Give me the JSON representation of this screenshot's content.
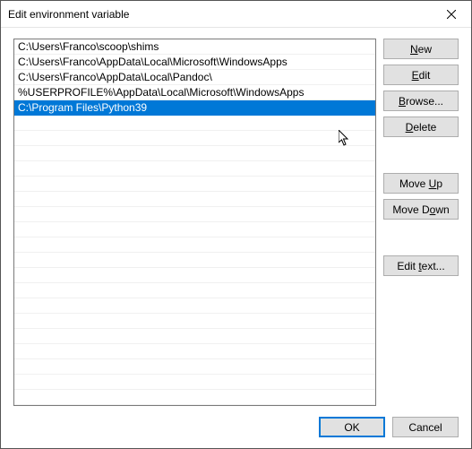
{
  "window": {
    "title": "Edit environment variable"
  },
  "list": {
    "items": [
      "C:\\Users\\Franco\\scoop\\shims",
      "C:\\Users\\Franco\\AppData\\Local\\Microsoft\\WindowsApps",
      "C:\\Users\\Franco\\AppData\\Local\\Pandoc\\",
      "%USERPROFILE%\\AppData\\Local\\Microsoft\\WindowsApps",
      "C:\\Program Files\\Python39"
    ],
    "selected_index": 4
  },
  "buttons": {
    "new_prefix": "N",
    "new_rest": "ew",
    "edit_prefix": "E",
    "edit_rest": "dit",
    "browse_prefix": "B",
    "browse_rest": "rowse...",
    "delete_prefix": "D",
    "delete_rest": "elete",
    "moveup_pre": "Move ",
    "moveup_u": "U",
    "moveup_post": "p",
    "movedown_pre": "Move D",
    "movedown_u": "o",
    "movedown_post": "wn",
    "edittext_pre": "Edit ",
    "edittext_u": "t",
    "edittext_post": "ext..."
  },
  "footer": {
    "ok": "OK",
    "cancel": "Cancel"
  }
}
